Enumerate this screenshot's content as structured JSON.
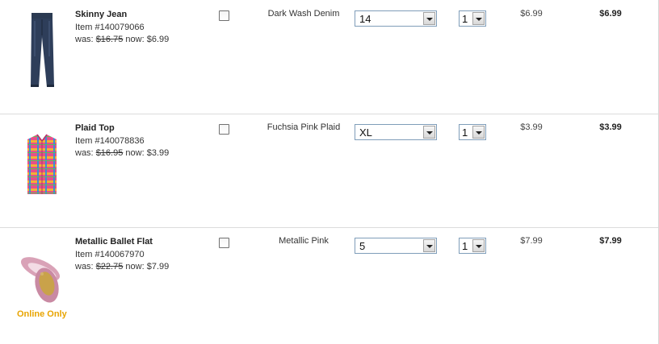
{
  "cart_items": [
    {
      "name": "Skinny Jean",
      "item_number": "Item #140079066",
      "was_label": "was:",
      "was_price": "$16.75",
      "now_label": "now:",
      "now_price": "$6.99",
      "color": "Dark Wash Denim",
      "size": "14",
      "quantity": "1",
      "price": "$6.99",
      "total": "$6.99",
      "image_icon": "jeans-icon"
    },
    {
      "name": "Plaid Top",
      "item_number": "Item #140078836",
      "was_label": "was:",
      "was_price": "$16.95",
      "now_label": "now:",
      "now_price": "$3.99",
      "color": "Fuchsia Pink Plaid",
      "size": "XL",
      "quantity": "1",
      "price": "$3.99",
      "total": "$3.99",
      "image_icon": "plaid-shirt-icon"
    },
    {
      "name": "Metallic Ballet Flat",
      "item_number": "Item #140067970",
      "was_label": "was:",
      "was_price": "$22.75",
      "now_label": "now:",
      "now_price": "$7.99",
      "color": "Metallic Pink",
      "size": "5",
      "quantity": "1",
      "price": "$7.99",
      "total": "$7.99",
      "badge": "Online Only",
      "badge_color": "#e8a400",
      "image_icon": "ballet-flat-icon"
    }
  ]
}
